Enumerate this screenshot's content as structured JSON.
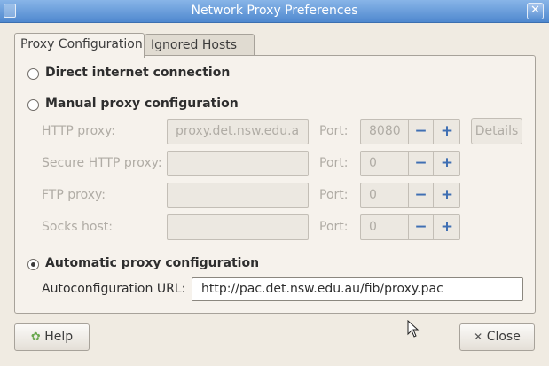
{
  "window": {
    "title": "Network Proxy Preferences"
  },
  "tabs": [
    "Proxy Configuration",
    "Ignored Hosts"
  ],
  "direct": {
    "label": "Direct internet connection",
    "selected": false
  },
  "manual": {
    "label": "Manual proxy configuration",
    "selected": false,
    "port_label": "Port:",
    "details_label": "Details",
    "rows": [
      {
        "label": "HTTP proxy:",
        "host": "proxy.det.nsw.edu.a",
        "port": "8080"
      },
      {
        "label": "Secure HTTP proxy:",
        "host": "",
        "port": "0"
      },
      {
        "label": "FTP proxy:",
        "host": "",
        "port": "0"
      },
      {
        "label": "Socks host:",
        "host": "",
        "port": "0"
      }
    ]
  },
  "automatic": {
    "label": "Automatic proxy configuration",
    "selected": true,
    "url_label": "Autoconfiguration URL:",
    "url": "http://pac.det.nsw.edu.au/fib/proxy.pac"
  },
  "buttons": {
    "help": "Help",
    "close": "Close"
  },
  "glyphs": {
    "minus": "−",
    "plus": "+",
    "close_x": "✕",
    "help_icon": "✿"
  }
}
